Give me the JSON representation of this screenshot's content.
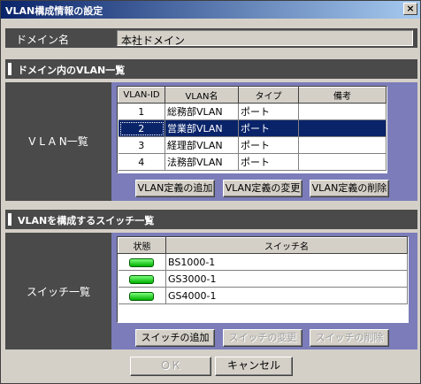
{
  "window": {
    "title": "VLAN構成情報の設定",
    "close_label": "×"
  },
  "domain": {
    "label": "ドメイン名",
    "value": "本社ドメイン"
  },
  "vlan_section": {
    "header": "ドメイン内のVLAN一覧",
    "side_label": "V L A N一覧",
    "columns": [
      "VLAN-ID",
      "VLAN名",
      "タイプ",
      "備考"
    ],
    "rows": [
      {
        "id": "1",
        "name": "総務部VLAN",
        "type": "ポート",
        "note": ""
      },
      {
        "id": "2",
        "name": "営業部VLAN",
        "type": "ポート",
        "note": ""
      },
      {
        "id": "3",
        "name": "経理部VLAN",
        "type": "ポート",
        "note": ""
      },
      {
        "id": "4",
        "name": "法務部VLAN",
        "type": "ポート",
        "note": ""
      }
    ],
    "selected_row": 2,
    "add_button": "VLAN定義の追加",
    "change_button": "VLAN定義の変更",
    "delete_button": "VLAN定義の削除"
  },
  "switch_section": {
    "header": "VLANを構成するスイッチ一覧",
    "side_label": "スイッチ一覧",
    "columns": [
      "状態",
      "スイッチ名"
    ],
    "rows": [
      {
        "status": "green-led-icon",
        "name": "BS1000-1"
      },
      {
        "status": "green-led-icon",
        "name": "GS3000-1"
      },
      {
        "status": "green-led-icon",
        "name": "GS4000-1"
      }
    ],
    "add_button": "スイッチの追加",
    "change_button": "スイッチの変更",
    "delete_button": "スイッチの削除"
  },
  "footer": {
    "ok_label": "ＯＫ",
    "cancel_label": "キャンセル"
  },
  "colors": {
    "title_bar": "#0a246a",
    "section_bar": "#4a4a4a",
    "panel": "#7b7cb9",
    "selection": "#0a246a",
    "led": "#00d000"
  }
}
